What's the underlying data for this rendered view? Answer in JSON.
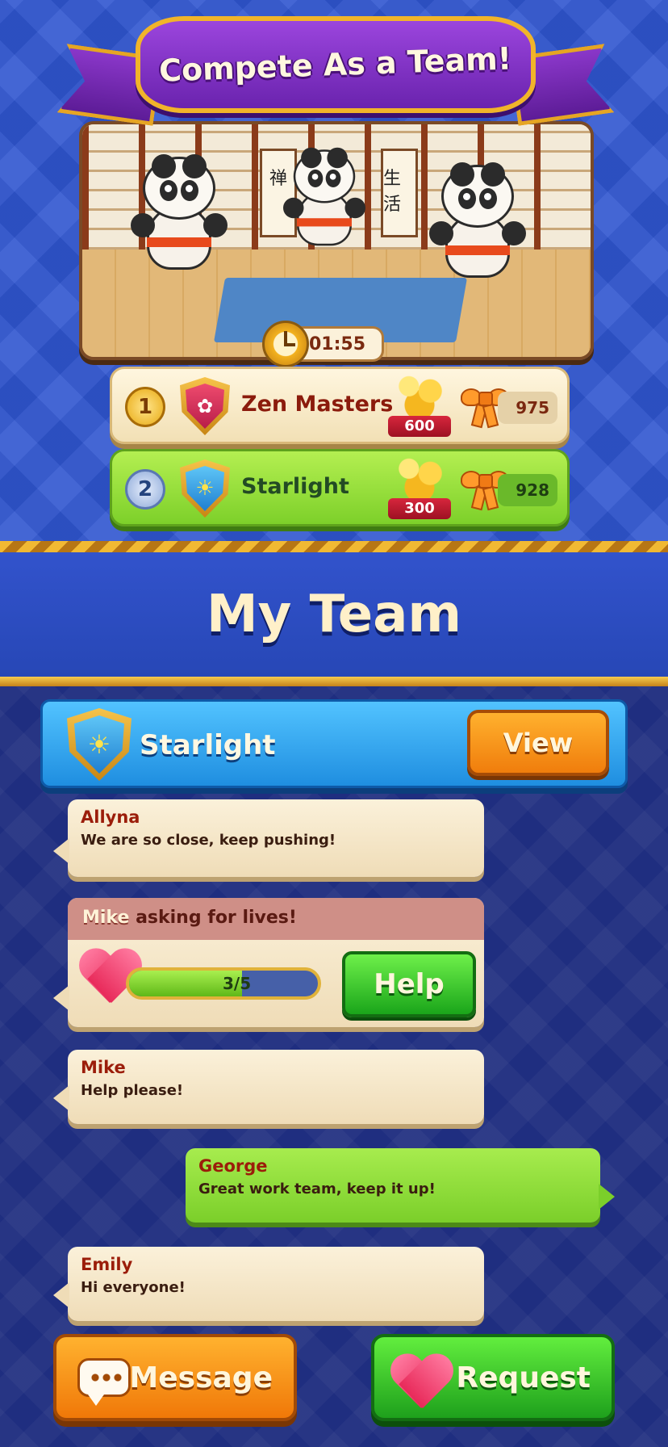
{
  "banner": {
    "title": "Compete As a Team!"
  },
  "scene": {
    "scroll_left": "禅",
    "scroll_right": "生活"
  },
  "timer": {
    "value": "01:55"
  },
  "leaderboard": [
    {
      "rank": "1",
      "name": "Zen Masters",
      "coins": "600",
      "score": "975",
      "shield": "lotus-shield-icon"
    },
    {
      "rank": "2",
      "name": "Starlight",
      "coins": "300",
      "score": "928",
      "shield": "sun-shield-icon"
    }
  ],
  "my_team": {
    "title": "My Team",
    "team_name": "Starlight",
    "view_label": "View"
  },
  "chat": [
    {
      "sender": "Allyna",
      "text": "We are so close, keep pushing!"
    },
    {
      "type": "lives_request",
      "who": "Mike",
      "text": " asking for lives!",
      "progress_label": "3/5",
      "progress_fraction": 0.6,
      "help_label": "Help"
    },
    {
      "sender": "Mike",
      "text": "Help please!"
    },
    {
      "sender": "George",
      "text": "Great work team, keep it up!",
      "own": true
    },
    {
      "sender": "Emily",
      "text": "Hi everyone!"
    }
  ],
  "actions": {
    "message_label": "Message",
    "request_label": "Request"
  },
  "colors": {
    "background_blue": "#2f55d0",
    "chat_bg": "#1f2e80",
    "orange_button": "#f07d0c",
    "green_button": "#1aa51a",
    "team_blue": "#1f8ee0"
  }
}
